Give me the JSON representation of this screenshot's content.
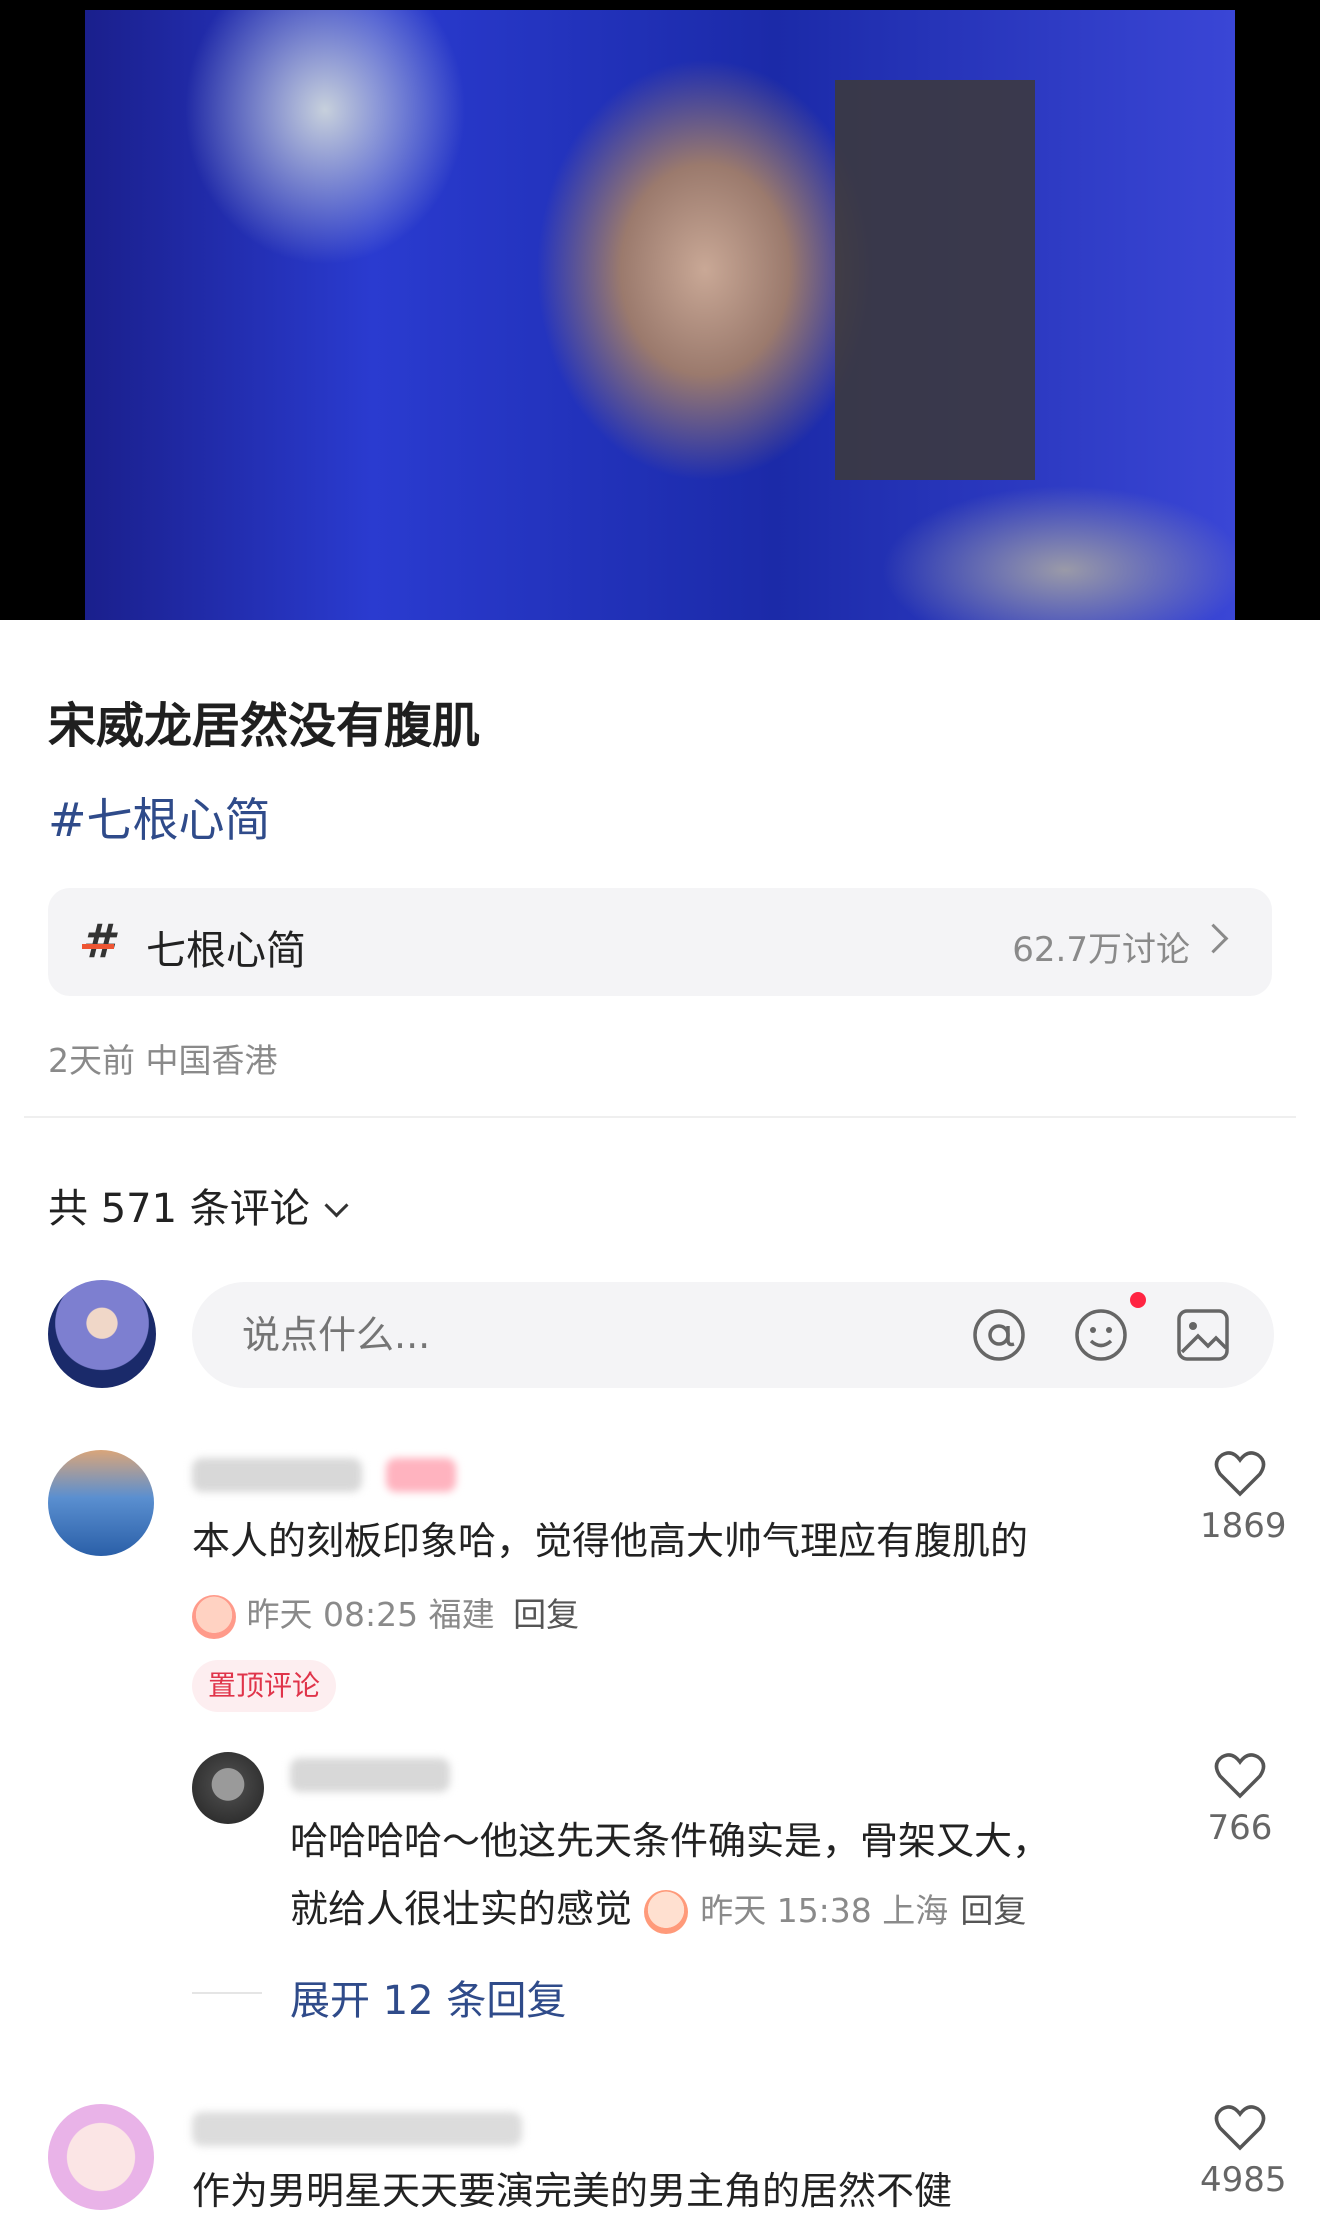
{
  "post": {
    "title": "宋威龙居然没有腹肌",
    "hashtag": "#七根心简",
    "topic_name": "七根心简",
    "topic_count": "62.7万讨论",
    "meta": "2天前 中国香港"
  },
  "comments_header": "共 571 条评论",
  "input": {
    "placeholder": "说点什么..."
  },
  "comments": [
    {
      "text": "本人的刻板印象哈，觉得他高大帅气理应有腹肌的",
      "time_location": "昨天 08:25 福建",
      "reply_label": "回复",
      "likes": "1869",
      "pin_label": "置顶评论"
    },
    {
      "text_line1": "哈哈哈哈～他这先天条件确实是，骨架又大，",
      "text_line2": "就给人很壮实的感觉",
      "time_location": "昨天 15:38 上海",
      "reply_label": "回复",
      "likes": "766"
    },
    {
      "text": "作为男明星天天要演完美的男主角的居然不健",
      "likes": "4985"
    }
  ],
  "expand_replies": "展开 12 条回复",
  "icons": [
    "hashtag-icon",
    "chevron-right-icon",
    "chevron-down-icon",
    "at-icon",
    "emoji-icon",
    "image-icon",
    "heart-icon"
  ],
  "colors": {
    "link": "#2f4b8a",
    "pin_text": "#e0344a",
    "pin_bg": "#fdeef0",
    "notify_dot": "#ff2442"
  }
}
